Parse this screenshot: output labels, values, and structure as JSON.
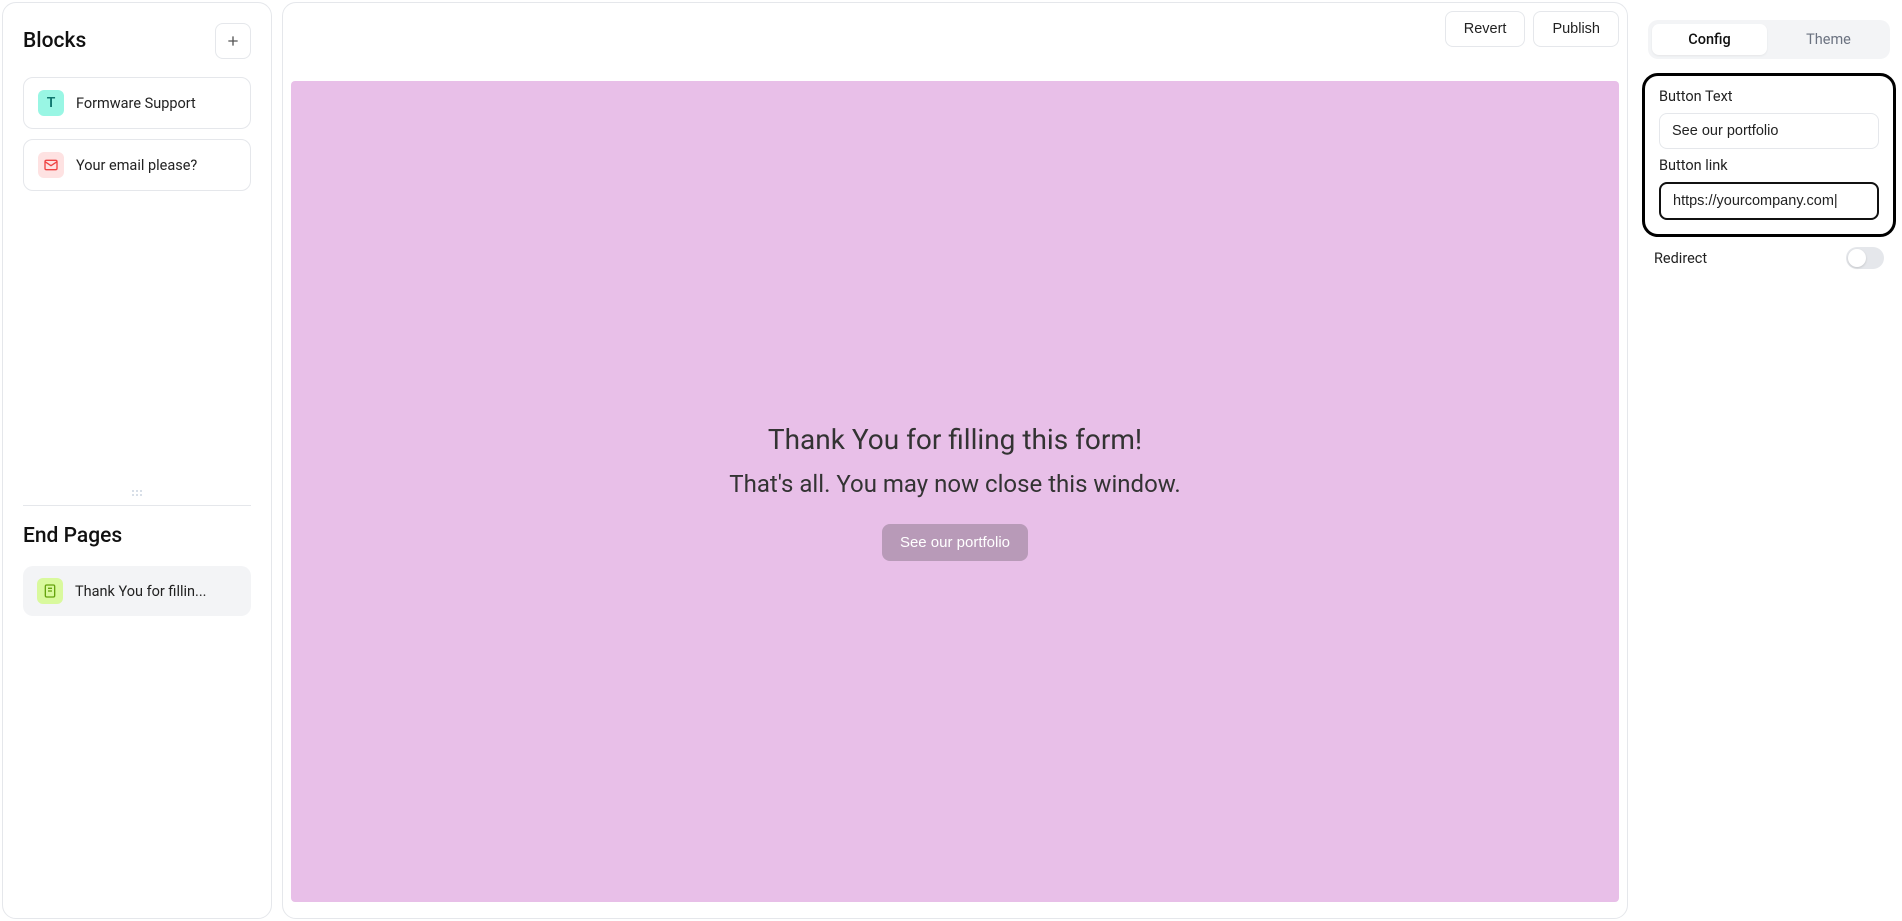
{
  "left": {
    "blocks_title": "Blocks",
    "items": [
      {
        "label": "Formware Support"
      },
      {
        "label": "Your email please?"
      }
    ],
    "end_pages_title": "End Pages",
    "end_pages": [
      {
        "label": "Thank You for fillin..."
      }
    ]
  },
  "toolbar": {
    "revert": "Revert",
    "publish": "Publish"
  },
  "canvas": {
    "heading": "Thank You for filling this form!",
    "subheading": "That's all. You may now close this window.",
    "cta": "See our portfolio"
  },
  "right": {
    "tabs": {
      "config": "Config",
      "theme": "Theme"
    },
    "button_text_label": "Button Text",
    "button_text_value": "See our portfolio",
    "button_link_label": "Button link",
    "button_link_value": "https://yourcompany.com|",
    "redirect_label": "Redirect"
  }
}
